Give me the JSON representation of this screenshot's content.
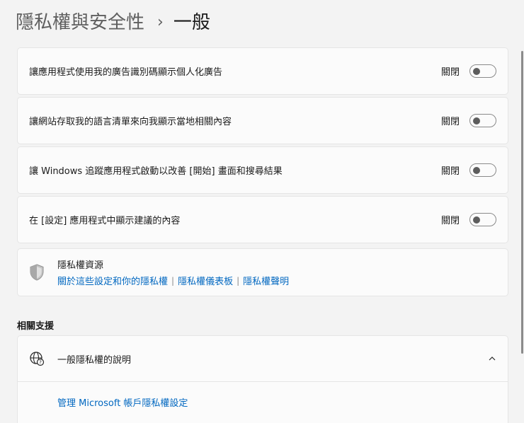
{
  "breadcrumb": {
    "parent": "隱私權與安全性",
    "separator": "›",
    "current": "一般"
  },
  "settings": [
    {
      "label": "讓應用程式使用我的廣告識別碼顯示個人化廣告",
      "state": "關閉",
      "on": false
    },
    {
      "label": "讓網站存取我的語言清單來向我顯示當地相關內容",
      "state": "關閉",
      "on": false
    },
    {
      "label": "讓 Windows 追蹤應用程式啟動以改善 [開始] 畫面和搜尋結果",
      "state": "關閉",
      "on": false
    },
    {
      "label": "在 [設定] 應用程式中顯示建議的內容",
      "state": "關閉",
      "on": false
    }
  ],
  "privacy_resources": {
    "title": "隱私權資源",
    "icon": "shield-icon",
    "links": [
      "關於這些設定和你的隱私權",
      "隱私權儀表板",
      "隱私權聲明"
    ],
    "link_separator": "|"
  },
  "related_support": {
    "section_title": "相關支援",
    "help_title": "一般隱私權的說明",
    "help_icon": "globe-help-icon",
    "expanded": true,
    "link": "管理 Microsoft 帳戶隱私權設定"
  },
  "colors": {
    "accent_link": "#0067c0",
    "background": "#f3f3f3",
    "card": "#fbfbfb"
  }
}
